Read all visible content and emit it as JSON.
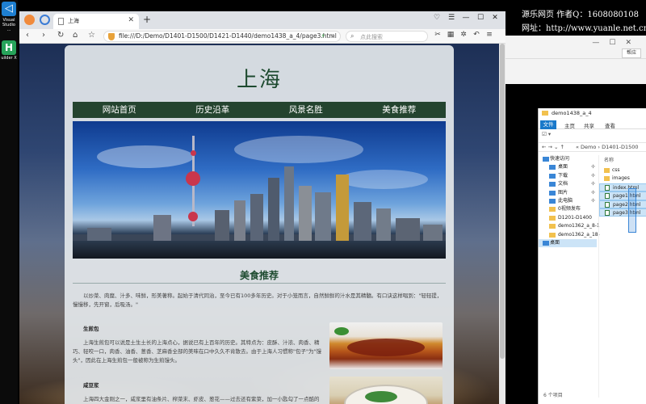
{
  "taskbar": {
    "vs_label": "Visual Studio ...",
    "hb_label": "uilder X"
  },
  "watermark": {
    "line1": "源乐网页 作者Q：1608080108",
    "line2": "网址：http://www.yuanle.net.cn/"
  },
  "bg_window": {
    "button": "帮应"
  },
  "browser": {
    "tab_title": "上海",
    "url": "file:///D:/Demo/D1401-D1500/D1421-D1440/demo1438_a_4/page3.html",
    "search_placeholder": "点此搜索"
  },
  "site": {
    "title": "上海",
    "menu": [
      "网站首页",
      "历史沿革",
      "风景名胜",
      "美食推荐"
    ],
    "section_title": "美食推荐",
    "intro": "以炒菜、肉糜、汁多、味鲜，形美著称。起始于清代同治，至今已有100多年历史。对于小笼而言，自然鲜鲜的汁水是其精髓。有口诀这样唱到：\"轻轻提，慢慢移，先开窗，后吸汤。\"",
    "food1": {
      "name": "生煎包",
      "desc": "上海生煎包可以说是土生土长的上海点心，据说已有上百年的历史。其特点为：皮酥、汁浓、肉香、精巧、轻咬一口，肉香、油香、葱香、芝麻香全部的美味在口中久久不肯散去。由于上海人习惯称\"包子\"为\"馒头\"，因此在上海生煎包一般被称为生煎馒头。"
    },
    "food2": {
      "name": "咸豆浆",
      "desc": "上海四大金刚之一，咸浆里有油条片、榨菜末、虾皮、葱花——过去还有紫菜，加一小匙勾了一点酷的鲜酱油，豆浆煮得滚烫，加上葱末而下的姿势，搞匿的咸浆就会起花。喝起来不光味道鲜美，而且爽心悦目。"
    }
  },
  "explorer": {
    "title": "demo1438_a_4",
    "ribbon": [
      "文件",
      "主页",
      "共享",
      "查看"
    ],
    "path": "« Demo  ›  D1401-D1500",
    "nav": [
      {
        "label": "快速访问",
        "type": "top"
      },
      {
        "label": "桌面",
        "type": "blue",
        "pin": true
      },
      {
        "label": "下载",
        "type": "blue",
        "pin": true
      },
      {
        "label": "文档",
        "type": "blue",
        "pin": true
      },
      {
        "label": "图片",
        "type": "blue",
        "pin": true
      },
      {
        "label": "此电脑",
        "type": "blue",
        "pin": true
      },
      {
        "label": "0视频发布",
        "type": "folder"
      },
      {
        "label": "D1201-D1400",
        "type": "folder"
      },
      {
        "label": "demo1362_a_8-1",
        "type": "folder"
      },
      {
        "label": "demo1362_a_18-",
        "type": "folder"
      },
      {
        "label": "桌面",
        "type": "top-sel"
      }
    ],
    "column_name": "名称",
    "files": [
      {
        "label": "css",
        "type": "folder"
      },
      {
        "label": "images",
        "type": "folder"
      },
      {
        "label": "index.html",
        "type": "html"
      },
      {
        "label": "page1.html",
        "type": "html"
      },
      {
        "label": "page2.html",
        "type": "html"
      },
      {
        "label": "page3.html",
        "type": "html"
      }
    ],
    "status": "6 个项目"
  },
  "colors": {
    "menu_bg": "#24442f",
    "title_green": "#1d4a2f",
    "explorer_accent": "#1979ca"
  }
}
